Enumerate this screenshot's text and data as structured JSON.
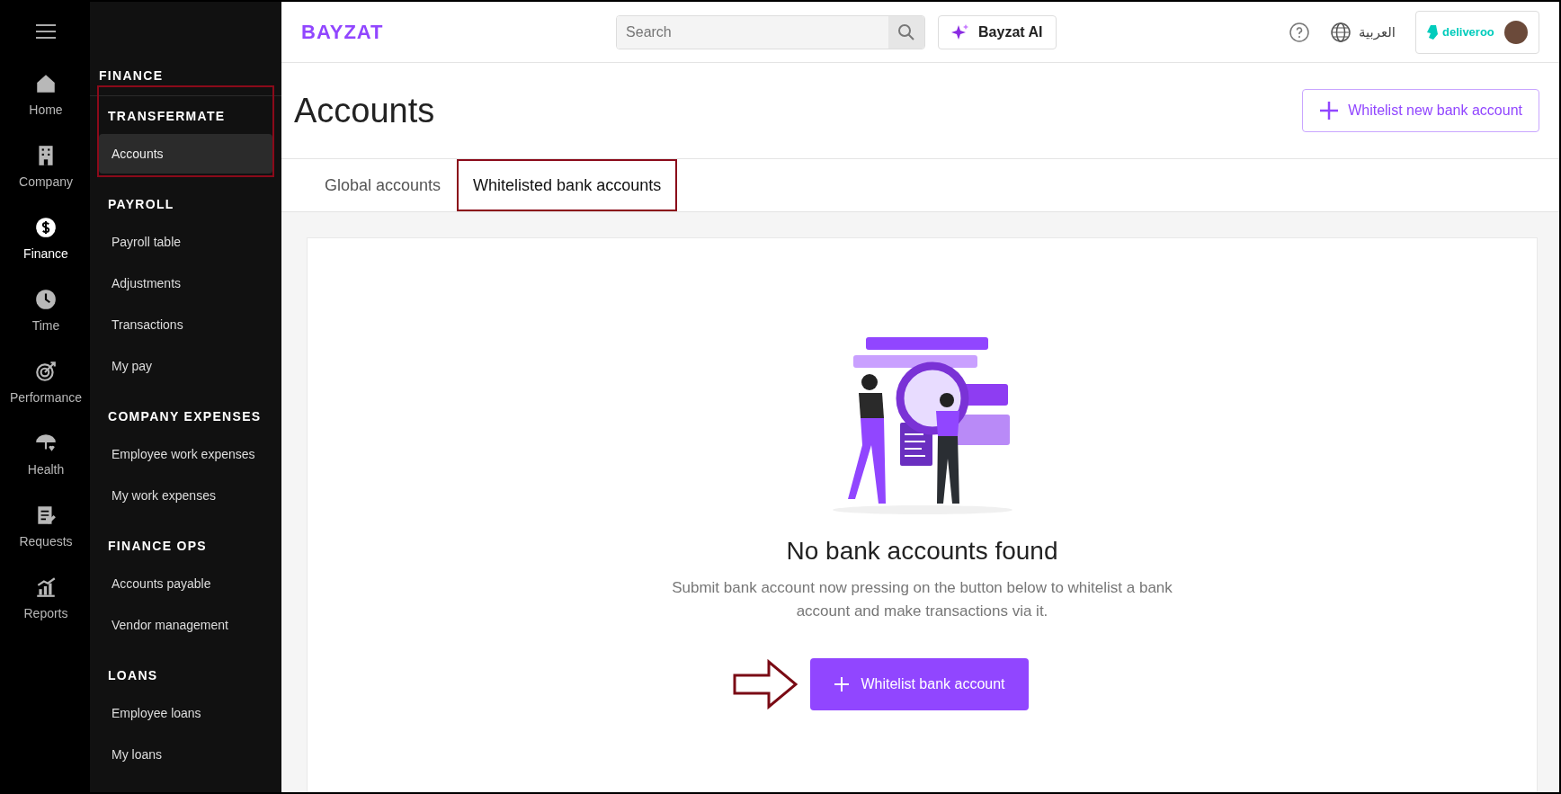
{
  "rail": {
    "items": [
      {
        "label": "Home",
        "kind": "home",
        "selected": false
      },
      {
        "label": "Company",
        "kind": "building",
        "selected": false
      },
      {
        "label": "Finance",
        "kind": "dollar",
        "selected": true
      },
      {
        "label": "Time",
        "kind": "clock",
        "selected": false
      },
      {
        "label": "Performance",
        "kind": "target",
        "selected": false
      },
      {
        "label": "Health",
        "kind": "umbrella",
        "selected": false
      },
      {
        "label": "Requests",
        "kind": "clipboard",
        "selected": false
      },
      {
        "label": "Reports",
        "kind": "chart",
        "selected": false
      }
    ]
  },
  "subnav": {
    "title": "FINANCE",
    "sections": [
      {
        "heading": "TRANSFERMATE",
        "highlighted": true,
        "items": [
          {
            "label": "Accounts",
            "selected": true
          }
        ]
      },
      {
        "heading": "PAYROLL",
        "highlighted": false,
        "items": [
          {
            "label": "Payroll table",
            "selected": false
          },
          {
            "label": "Adjustments",
            "selected": false
          },
          {
            "label": "Transactions",
            "selected": false
          },
          {
            "label": "My pay",
            "selected": false
          }
        ]
      },
      {
        "heading": "COMPANY EXPENSES",
        "highlighted": false,
        "items": [
          {
            "label": "Employee work expenses",
            "selected": false
          },
          {
            "label": "My work expenses",
            "selected": false
          }
        ]
      },
      {
        "heading": "FINANCE OPS",
        "highlighted": false,
        "items": [
          {
            "label": "Accounts payable",
            "selected": false
          },
          {
            "label": "Vendor management",
            "selected": false
          }
        ]
      },
      {
        "heading": "LOANS",
        "highlighted": false,
        "items": [
          {
            "label": "Employee loans",
            "selected": false
          },
          {
            "label": "My loans",
            "selected": false
          }
        ]
      }
    ]
  },
  "topbar": {
    "logo": "BAYZAT",
    "search": {
      "placeholder": "Search"
    },
    "ai_button": "Bayzat AI",
    "language": "العربية",
    "company_logo": "deliveroo"
  },
  "page": {
    "title": "Accounts",
    "action_button": "Whitelist new bank account"
  },
  "tabs": [
    {
      "label": "Global accounts",
      "selected": false,
      "highlighted": false
    },
    {
      "label": "Whitelisted bank accounts",
      "selected": true,
      "highlighted": true
    }
  ],
  "empty_state": {
    "title": "No bank accounts found",
    "description": "Submit bank account now pressing on the button below to whitelist a bank account and make transactions via it.",
    "button": "Whitelist bank account",
    "pointer_arrow": true
  }
}
